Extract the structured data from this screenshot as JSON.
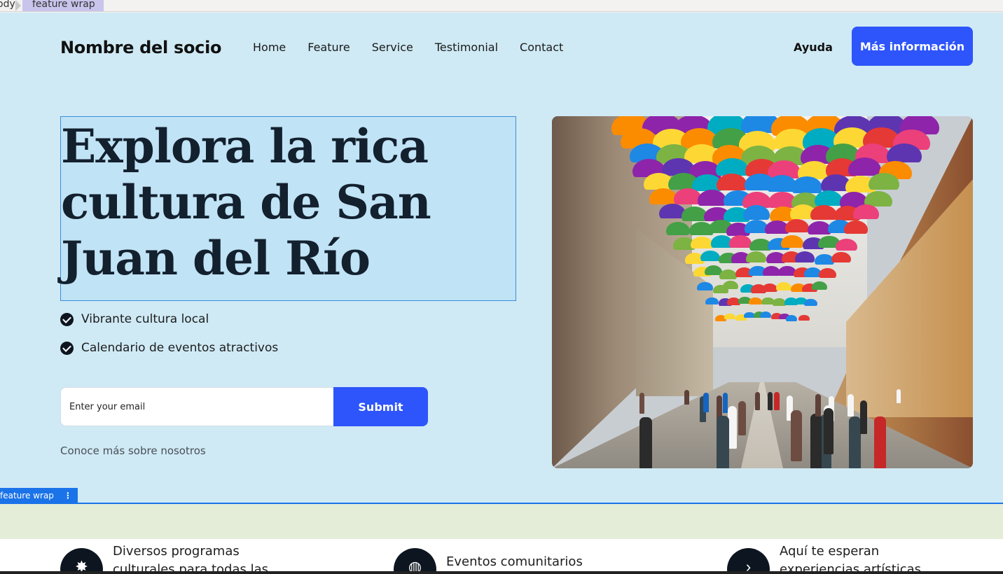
{
  "editor": {
    "breadcrumb_body": "ody",
    "breadcrumb_active": "feature wrap",
    "selection_tag": "feature wrap",
    "selection_menu": "⋮"
  },
  "header": {
    "brand": "Nombre del socio",
    "nav": [
      "Home",
      "Feature",
      "Service",
      "Testimonial",
      "Contact"
    ],
    "help": "Ayuda",
    "cta": "Más información"
  },
  "hero": {
    "title": "Explora la rica cultura de San Juan del Río",
    "checks": [
      "Vibrante cultura local",
      "Calendario de eventos atractivos"
    ],
    "email_placeholder": "Enter your email",
    "submit": "Submit",
    "learn_more": "Conoce más sobre nosotros"
  },
  "features": [
    {
      "icon": "flower-icon",
      "glyph": "✸",
      "text": "Diversos programas culturales para todas las"
    },
    {
      "icon": "globe-icon",
      "glyph": "◍",
      "text": "Eventos comunitarios"
    },
    {
      "icon": "arrow-right-icon",
      "glyph": "›",
      "text": "Aquí te esperan experiencias artísticas"
    }
  ],
  "colors": {
    "accent": "#2d55fb",
    "page_bg": "#cfeaf5",
    "selection": "#1a73e8"
  }
}
